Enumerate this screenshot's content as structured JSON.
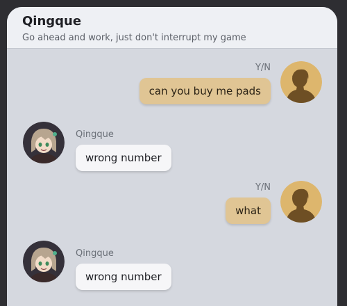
{
  "chat": {
    "contact_name": "Qingque",
    "status_text": "Go ahead and work, just don't interrupt my game"
  },
  "colors": {
    "outgoing_bubble": "#e0c594",
    "incoming_bubble": "#f6f6f8",
    "background": "#d5d8df"
  },
  "messages": [
    {
      "sender": "Y/N",
      "text": "can you buy me pads",
      "direction": "outgoing"
    },
    {
      "sender": "Qingque",
      "text": "wrong number",
      "direction": "incoming"
    },
    {
      "sender": "Y/N",
      "text": "what",
      "direction": "outgoing"
    },
    {
      "sender": "Qingque",
      "text": "wrong number",
      "direction": "incoming"
    }
  ]
}
